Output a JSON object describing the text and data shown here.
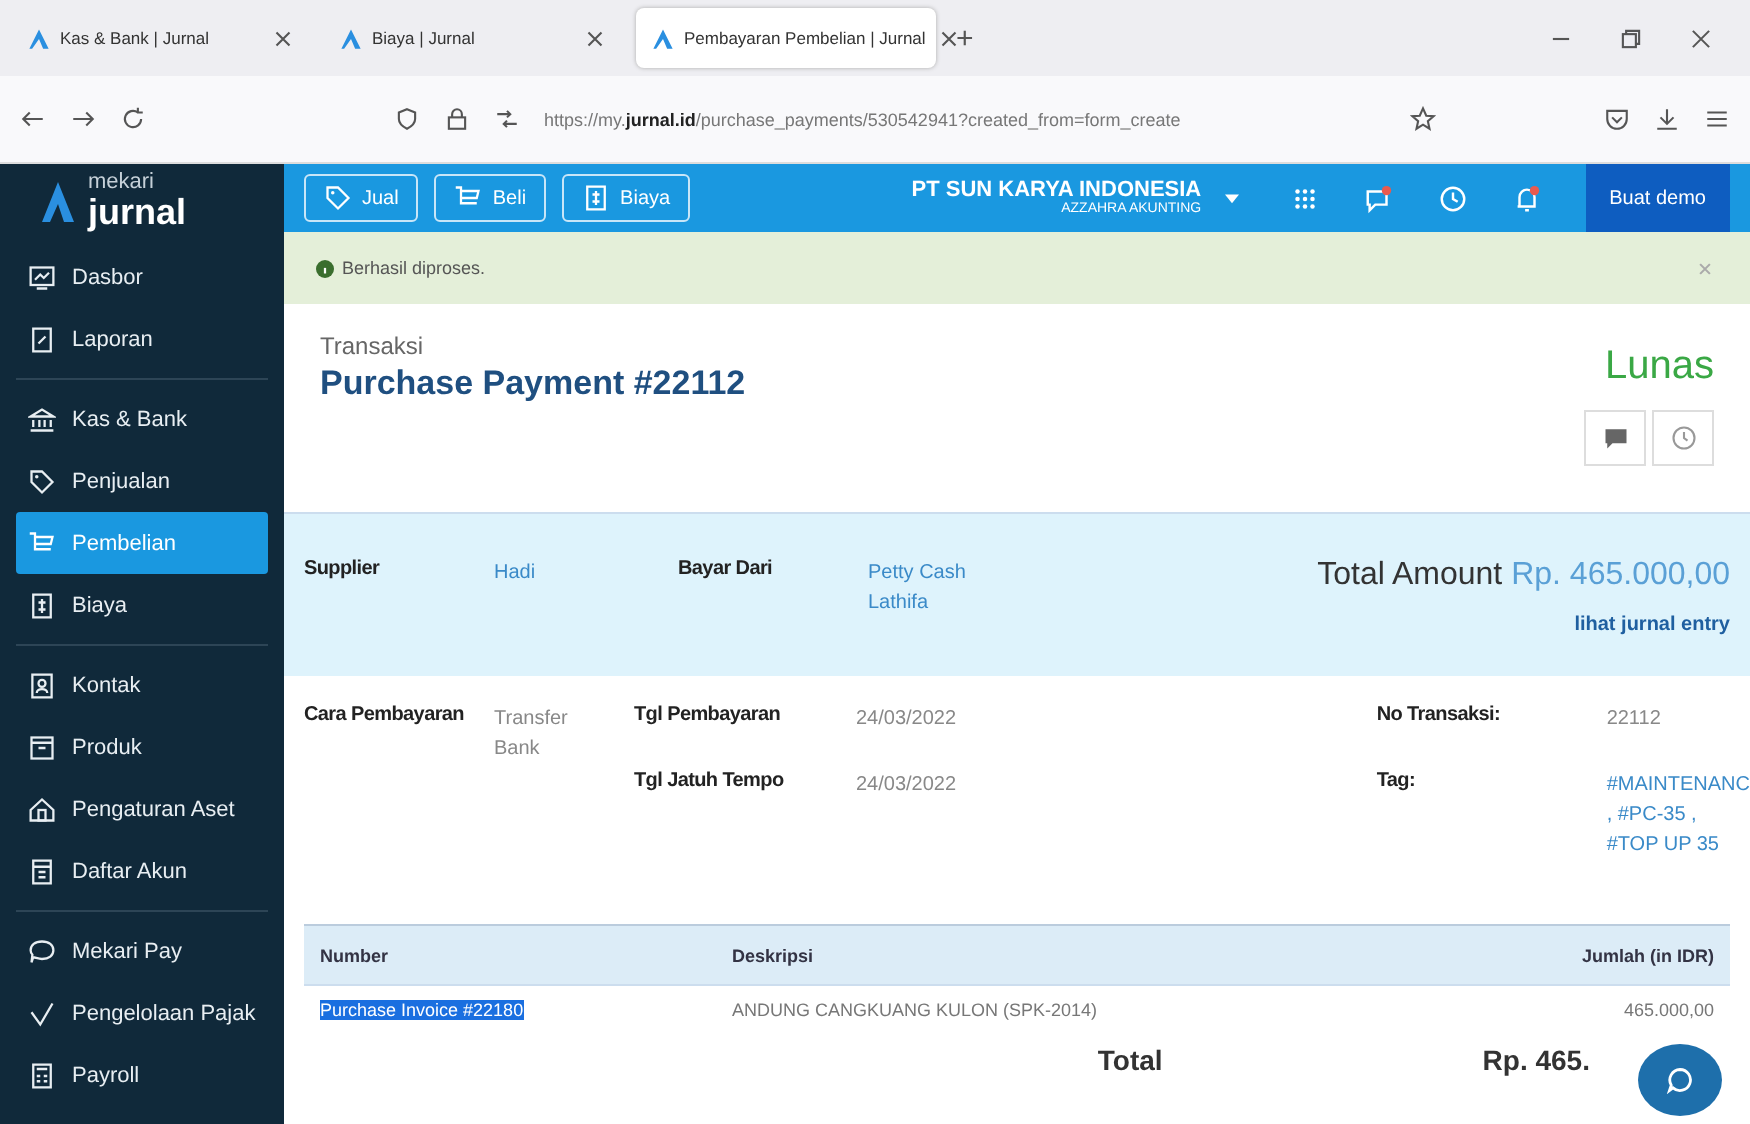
{
  "browser": {
    "tabs": [
      {
        "label": "Kas & Bank | Jurnal",
        "selected": false
      },
      {
        "label": "Biaya | Jurnal",
        "selected": false
      },
      {
        "label": "Pembayaran Pembelian | Jurnal",
        "selected": true
      }
    ],
    "new_tab": "+",
    "url": "https://my.**jurnal.id**/purchase_payments/530542941?created_from=form_create"
  },
  "sidebar": {
    "logo_top": "mekari",
    "logo_bottom": "jurnal",
    "groups": [
      [
        {
          "label": "Dasbor",
          "selected": false
        },
        {
          "label": "Laporan",
          "selected": false
        }
      ],
      [
        {
          "label": "Kas & Bank",
          "selected": false
        },
        {
          "label": "Penjualan",
          "selected": false
        },
        {
          "label": "Pembelian",
          "selected": true
        },
        {
          "label": "Biaya",
          "selected": false
        }
      ],
      [
        {
          "label": "Kontak",
          "selected": false
        },
        {
          "label": "Produk",
          "selected": false
        },
        {
          "label": "Pengaturan Aset",
          "selected": false
        },
        {
          "label": "Daftar Akun",
          "selected": false
        }
      ],
      [
        {
          "label": "Mekari Pay",
          "selected": false
        },
        {
          "label": "Pengelolaan Pajak",
          "selected": false
        },
        {
          "label": "Payroll",
          "selected": false
        }
      ]
    ]
  },
  "header": {
    "actions": [
      "Jual",
      "Beli",
      "Biaya"
    ],
    "company": "PT SUN KARYA INDONESIA",
    "company_sub": "AZZAHRA AKUNTING",
    "demo_button": "Buat demo"
  },
  "alert": {
    "text": "Berhasil diproses."
  },
  "transaction": {
    "label": "Transaksi",
    "title": "Purchase Payment #22112",
    "status": "Lunas"
  },
  "summary": {
    "fields": [
      {
        "label": "Supplier",
        "value": [
          "Hadi"
        ]
      },
      {
        "label": "Bayar Dari",
        "value": [
          "Petty Cash",
          "Lathifa"
        ]
      }
    ],
    "total_label": "Total Amount",
    "total_value": "Rp. 465.000,00",
    "journal_link": "lihat jurnal entry"
  },
  "details": {
    "left": [
      {
        "label": "Cara Pembayaran",
        "value": [
          "Transfer",
          "Bank"
        ]
      }
    ],
    "middle": [
      {
        "label": "Tgl Pembayaran",
        "value": "24/03/2022"
      },
      {
        "label": "Tgl Jatuh Tempo",
        "value": "24/03/2022"
      }
    ],
    "right": [
      {
        "label": "No Transaksi:",
        "value": [
          "22112"
        ],
        "link": false
      },
      {
        "label": "Tag:",
        "value": [
          "#MAINTENANC",
          ", #PC-35 ,",
          "#TOP UP 35"
        ],
        "link": true
      }
    ]
  },
  "table": {
    "columns": [
      "Number",
      "Deskripsi",
      "Jumlah (in IDR)"
    ],
    "rows": [
      {
        "number": "Purchase Invoice #22180",
        "selected": true,
        "description": "ANDUNG CANGKUANG KULON (SPK-2014)",
        "amount": "465.000,00"
      }
    ],
    "total_label": "Total",
    "total_value": "Rp. 465."
  }
}
